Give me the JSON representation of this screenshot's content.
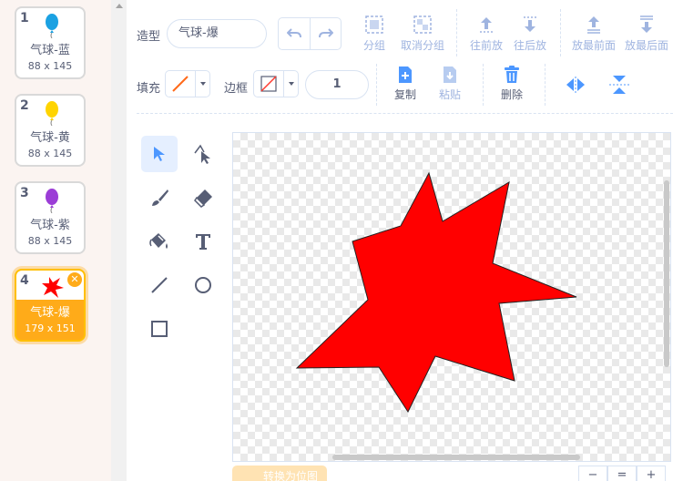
{
  "costumes": [
    {
      "number": "1",
      "name": "气球-蓝",
      "size": "88 x 145",
      "color": "#1ba1e2"
    },
    {
      "number": "2",
      "name": "气球-黄",
      "size": "88 x 145",
      "color": "#ffd400"
    },
    {
      "number": "3",
      "name": "气球-紫",
      "size": "88 x 145",
      "color": "#9b3dd6"
    },
    {
      "number": "4",
      "name": "气球-爆",
      "size": "179 x 151",
      "color": "#ff0000",
      "selected": true
    }
  ],
  "toolbar": {
    "costume_label": "造型",
    "costume_name": "气球-爆",
    "fill_label": "填充",
    "outline_label": "边框",
    "outline_width": "1",
    "group": "分组",
    "ungroup": "取消分组",
    "forward": "往前放",
    "backward": "往后放",
    "front": "放最前面",
    "back": "放最后面",
    "copy": "复制",
    "paste": "粘贴",
    "delete": "删除"
  },
  "bottom": {
    "bitmap_button": "转换为位图",
    "zoom_out": "−",
    "zoom_reset": "=",
    "zoom_in": "+"
  },
  "colors": {
    "accent": "#ffab19",
    "blue": "#4c97ff",
    "shape_fill": "#ff0000",
    "text": "#575e75"
  }
}
